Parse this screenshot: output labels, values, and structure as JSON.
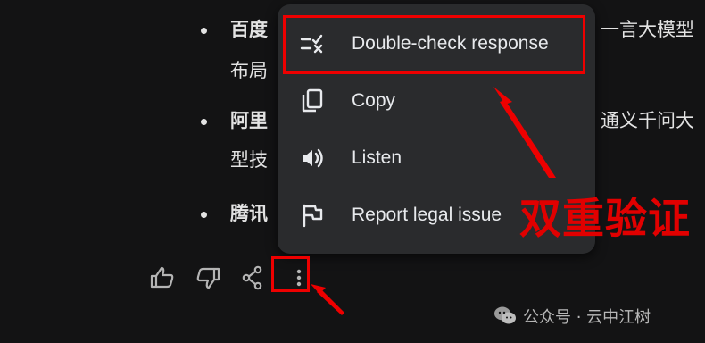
{
  "bullets": [
    {
      "head": "百度",
      "tail": "一言大模型",
      "cont": "布局"
    },
    {
      "head": "阿里",
      "tail": "通义千问大",
      "cont": "型技"
    },
    {
      "head": "腾讯",
      "tail": "",
      "cont": ""
    }
  ],
  "menu": {
    "items": [
      {
        "label": "Double-check response",
        "icon": "double-check-icon"
      },
      {
        "label": "Copy",
        "icon": "copy-icon"
      },
      {
        "label": "Listen",
        "icon": "speaker-icon"
      },
      {
        "label": "Report legal issue",
        "icon": "flag-icon"
      }
    ]
  },
  "actions": [
    {
      "icon": "thumb-up-icon"
    },
    {
      "icon": "thumb-down-icon"
    },
    {
      "icon": "share-icon"
    },
    {
      "icon": "more-vert-icon"
    }
  ],
  "annotation": {
    "text": "双重验证"
  },
  "watermark": {
    "text": "公众号 · 云中江树"
  },
  "colors": {
    "background": "#131314",
    "menu": "#2a2b2d",
    "highlight": "#e00000",
    "text": "#e3e3e3"
  }
}
